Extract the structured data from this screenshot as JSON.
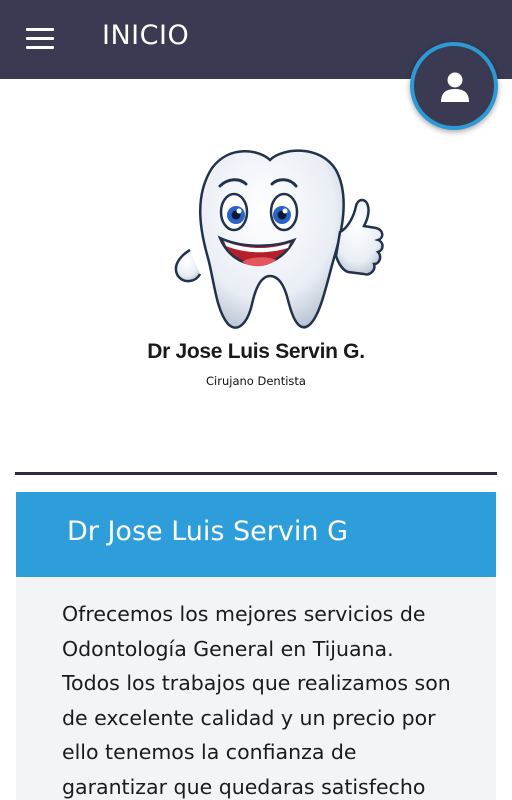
{
  "header": {
    "title": "INICIO",
    "menu_icon": "hamburger-menu-icon",
    "profile_icon": "user-icon",
    "bg_color": "#3a3a52",
    "accent_color": "#2d9ad6"
  },
  "logo": {
    "name": "Dr Jose Luis Servin G.",
    "subtitle": "Cirujano Dentista",
    "image": "smiling-tooth-thumbs-up"
  },
  "card": {
    "title": "Dr Jose Luis Servin G",
    "title_bg": "#2d9ed9",
    "body_lines": [
      "Ofrecemos los mejores servicios de",
      "Odontología General en Tijuana.",
      "Todos los trabajos que realizamos son",
      "de excelente calidad y un precio por",
      "ello tenemos la confianza de",
      "garantizar que quedaras satisfecho"
    ]
  }
}
